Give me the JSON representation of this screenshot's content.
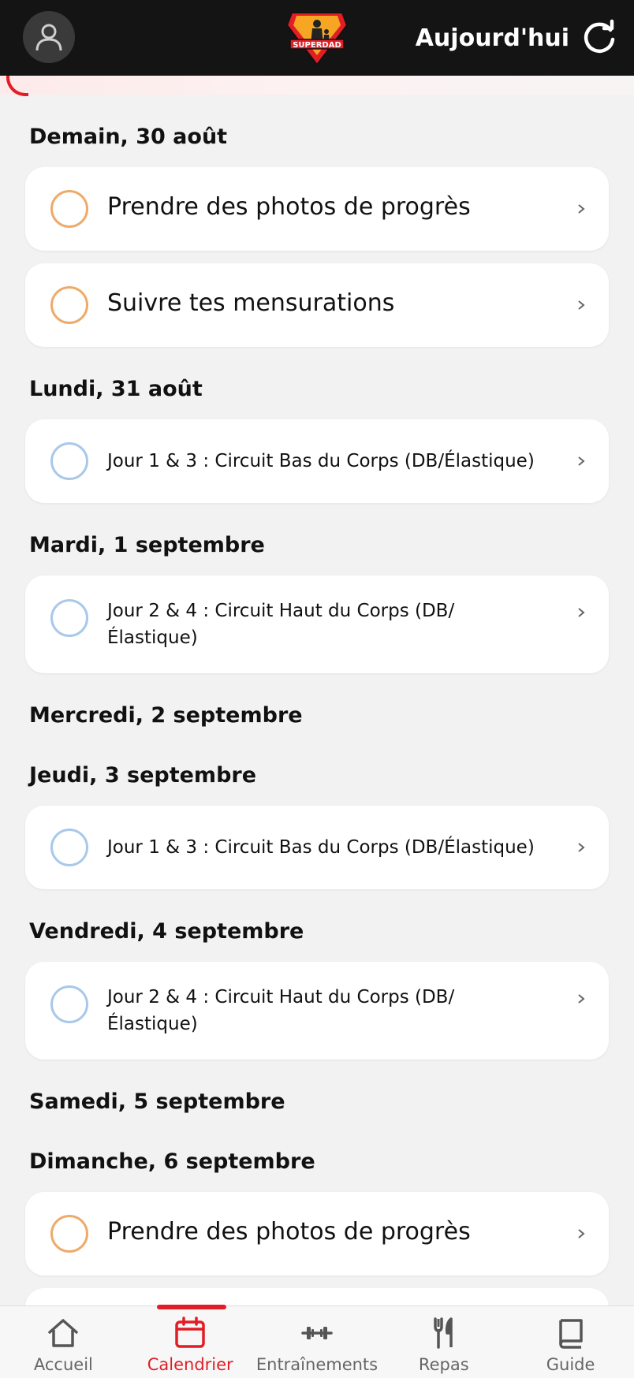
{
  "header": {
    "today_label": "Aujourd'hui",
    "logo_text": "SUPERDAD"
  },
  "days": [
    {
      "label": "Demain, 30 août",
      "tasks": [
        {
          "title": "Prendre des photos de progrès",
          "kind": "orange"
        },
        {
          "title": "Suivre tes mensurations",
          "kind": "orange"
        }
      ]
    },
    {
      "label": "Lundi, 31 août",
      "tasks": [
        {
          "title": "Jour 1 & 3 : Circuit Bas du Corps (DB/Élastique)",
          "kind": "blue"
        }
      ]
    },
    {
      "label": "Mardi, 1 septembre",
      "tasks": [
        {
          "title": "Jour 2 & 4 : Circuit Haut du Corps (DB/ Élastique)",
          "kind": "blue"
        }
      ]
    },
    {
      "label": "Mercredi, 2 septembre",
      "tasks": []
    },
    {
      "label": "Jeudi, 3 septembre",
      "tasks": [
        {
          "title": "Jour 1 & 3 : Circuit Bas du Corps (DB/Élastique)",
          "kind": "blue"
        }
      ]
    },
    {
      "label": "Vendredi, 4 septembre",
      "tasks": [
        {
          "title": "Jour 2 & 4 : Circuit Haut du Corps (DB/ Élastique)",
          "kind": "blue"
        }
      ]
    },
    {
      "label": "Samedi, 5 septembre",
      "tasks": []
    },
    {
      "label": "Dimanche, 6 septembre",
      "tasks": [
        {
          "title": "Prendre des photos de progrès",
          "kind": "orange"
        }
      ]
    }
  ],
  "nav": {
    "items": [
      {
        "label": "Accueil",
        "icon": "home-icon"
      },
      {
        "label": "Calendrier",
        "icon": "calendar-icon"
      },
      {
        "label": "Entraînements",
        "icon": "dumbbell-icon"
      },
      {
        "label": "Repas",
        "icon": "utensils-icon"
      },
      {
        "label": "Guide",
        "icon": "book-icon"
      }
    ],
    "active_index": 1
  },
  "colors": {
    "accent": "#e11d25",
    "header_bg": "#141414",
    "ring_orange": "#eeaa6a",
    "ring_blue": "#a9c8ea"
  }
}
